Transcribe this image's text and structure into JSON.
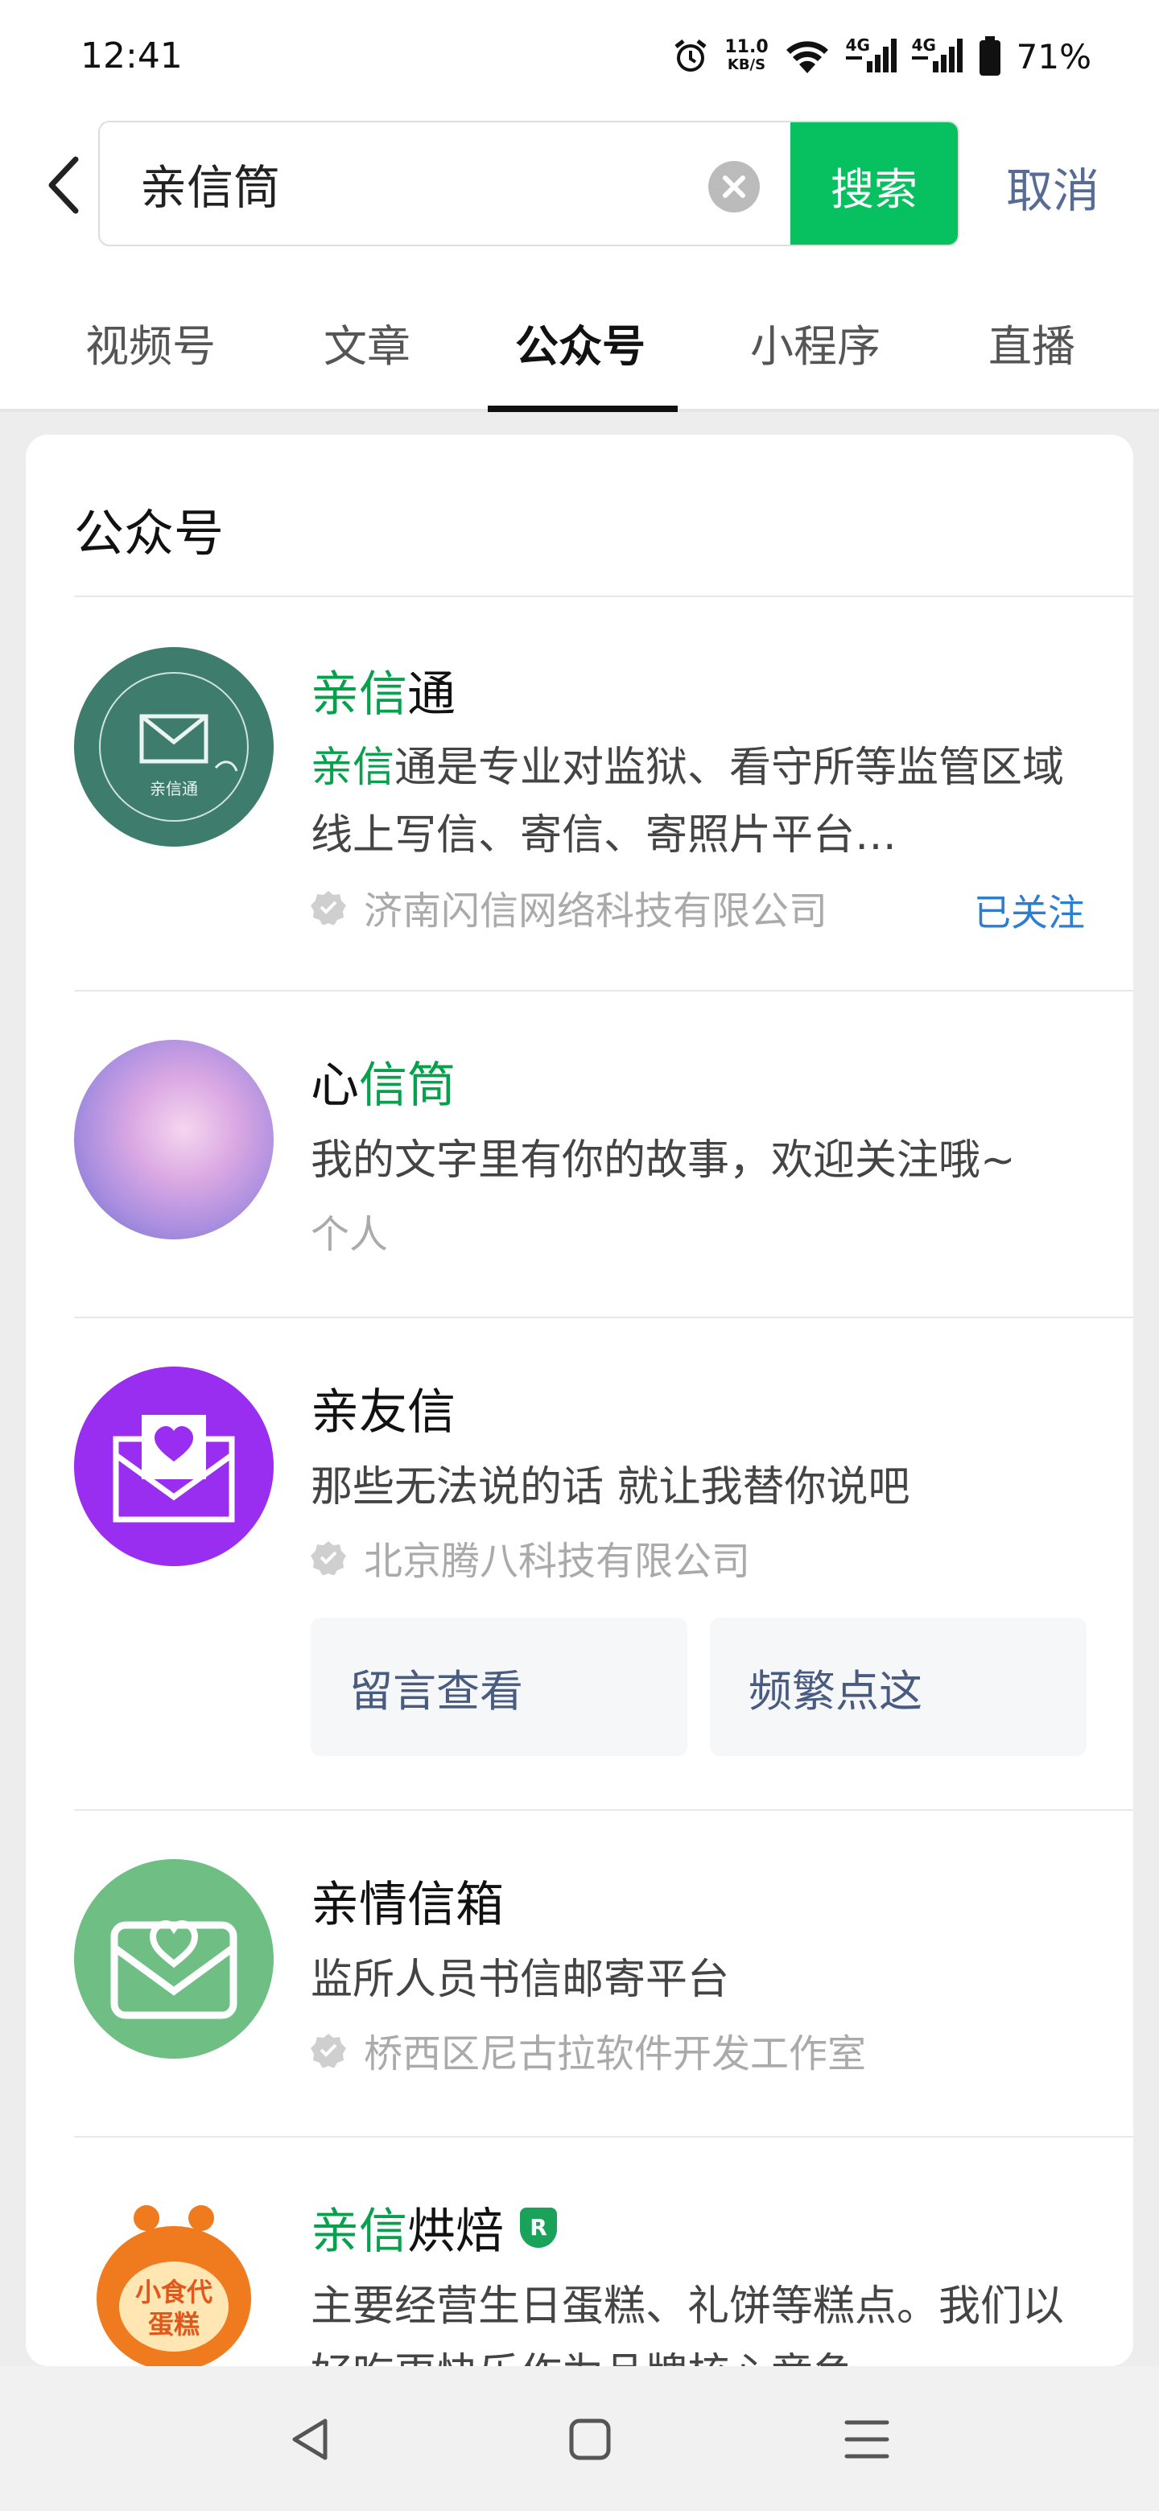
{
  "status": {
    "time": "12:41",
    "speed_top": "11.0",
    "speed_bottom": "KB/S",
    "battery": "71%",
    "net1": "4G",
    "net2": "4G"
  },
  "search": {
    "query": "亲信筒",
    "button": "搜索",
    "cancel": "取消"
  },
  "tabs": [
    {
      "label": "视频号"
    },
    {
      "label": "文章"
    },
    {
      "label": "公众号"
    },
    {
      "label": "小程序"
    },
    {
      "label": "直播"
    }
  ],
  "section_title": "公众号",
  "results": [
    {
      "name_hl": "亲信",
      "name_rest": "通",
      "desc_hl": "亲信",
      "desc_rest": "通是专业对监狱、看守所等监管区域线上写信、寄信、寄照片平台…",
      "org": "济南闪信网络科技有限公司",
      "status": "已关注",
      "avatar_text": "亲信通"
    },
    {
      "name_pre": "心",
      "name_hl": "信筒",
      "desc": "我的文字里有你的故事，欢迎关注哦~",
      "type": "个人"
    },
    {
      "name": "亲友信",
      "desc": "那些无法说的话 就让我替你说吧",
      "org": "北京腾八科技有限公司",
      "buttons": [
        "留言查看",
        "频繁点这"
      ]
    },
    {
      "name": "亲情信箱",
      "desc": "监所人员书信邮寄平台",
      "org": "桥西区尼古拉软件开发工作室"
    },
    {
      "name_hl": "亲信",
      "name_rest": "烘焙",
      "badge": "R",
      "desc": "主要经营生日蛋糕、礼饼等糕点。我们以好吃更快乐作为品牌核心竞争",
      "avatar_text": "小食代蛋糕"
    }
  ],
  "colors": {
    "accent": "#07c160",
    "highlight": "#07a04d",
    "link": "#576b95",
    "followed": "#2b7ed2"
  }
}
